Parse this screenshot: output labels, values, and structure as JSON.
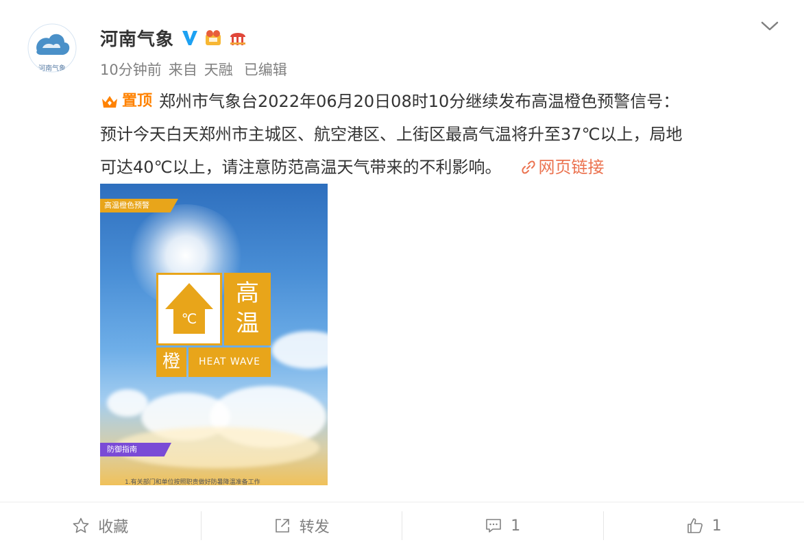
{
  "account": {
    "name": "河南气象",
    "avatar_label": "河南气象"
  },
  "meta": {
    "time": "10分钟前",
    "source_prefix": "来自",
    "source": "天融",
    "edited": "已编辑"
  },
  "post": {
    "pin_label": "置顶",
    "line1": "郑州市气象台2022年06月20日08时10分继续发布高温橙色预警信号：",
    "line2": "预计今天白天郑州市主城区、航空港区、上街区最高气温将升至37℃以上，局地",
    "line3": "可达40℃以上，请注意防范高温天气带来的不利影响。",
    "link_label": "网页链接"
  },
  "image": {
    "top_banner": "高温橙色预警",
    "sign_hot_1": "高",
    "sign_hot_2": "温",
    "sign_degree": "℃",
    "sign_orange": "橙",
    "sign_en": "HEAT WAVE",
    "bottom_banner": "防御指南",
    "caption": "1.有关部门和单位按照职责做好防暑降温准备工作"
  },
  "actions": {
    "favorite": "收藏",
    "repost": "转发",
    "comment_count": "1",
    "like_count": "1"
  },
  "colors": {
    "accent_orange": "#ff8200",
    "link": "#eb7350",
    "verified_blue": "#1da1f2",
    "warning_orange": "#e8a51a"
  }
}
